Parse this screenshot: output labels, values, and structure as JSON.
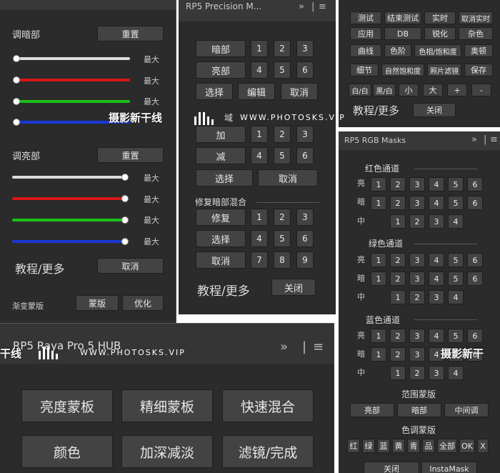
{
  "p1": {
    "dark_label": "调暗部",
    "reset": "重置",
    "max": "最大",
    "light_label": "调亮部",
    "tutorial": "教程/更多",
    "cancel": "取消",
    "gradient_mask": "渐变蒙版",
    "mask": "蒙版",
    "optimize": "优化"
  },
  "p2": {
    "title": "RP5 Precision M...",
    "dark": "暗部",
    "bright": "亮部",
    "select": "选择",
    "edit": "编辑",
    "cancel": "取消",
    "area_fragment": "域",
    "add": "加",
    "sub": "减",
    "repair_title": "修复暗部混合",
    "repair": "修复",
    "tutorial": "教程/更多",
    "close": "关闭",
    "nums": [
      "1",
      "2",
      "3",
      "4",
      "5",
      "6",
      "7",
      "8",
      "9"
    ]
  },
  "p3": {
    "row1": [
      "测试",
      "结束测试",
      "实时",
      "取消实时"
    ],
    "row2": [
      "应用",
      "DB",
      "锐化",
      "杂色"
    ],
    "row3": [
      "曲线",
      "色阶",
      "色相/饱和度",
      "奥顿"
    ],
    "row4": [
      "细节",
      "自然饱和度",
      "照片滤镜",
      "保存"
    ],
    "row5": [
      "白/白",
      "黑/白",
      "小",
      "大",
      "+",
      "-"
    ],
    "tutorial": "教程/更多",
    "close": "关闭"
  },
  "p4": {
    "title": "RP5 RGB Masks",
    "red": "红色通道",
    "green": "绿色通道",
    "blue": "蓝色通道",
    "bright": "亮",
    "dark": "暗",
    "mid": "中",
    "range": "范围蒙版",
    "range_btns": [
      "亮部",
      "暗部",
      "中间调"
    ],
    "tone": "色调蒙版",
    "tone_btns": [
      "红",
      "绿",
      "蓝",
      "黄",
      "青",
      "品",
      "全部",
      "OK",
      "X"
    ],
    "close": "关闭",
    "instamask": "InstaMask"
  },
  "p5": {
    "title": "RP5 Raya Pro 5 HUB",
    "btns": [
      "亮度蒙板",
      "精细蒙板",
      "快速混合",
      "颜色",
      "加深减淡",
      "滤镜/完成"
    ]
  },
  "watermark": {
    "cn": "摄影新干线",
    "cn_frag": "干线",
    "cn_frag2": "摄影新干",
    "url": "WWW.PHOTOSKS.VIP"
  },
  "icons": {
    "expand": "»",
    "sep": "|",
    "menu": "≡"
  },
  "colors": {
    "red": "#d81818",
    "green": "#18c018",
    "blue": "#1838d8",
    "white": "#dcdcdc"
  }
}
